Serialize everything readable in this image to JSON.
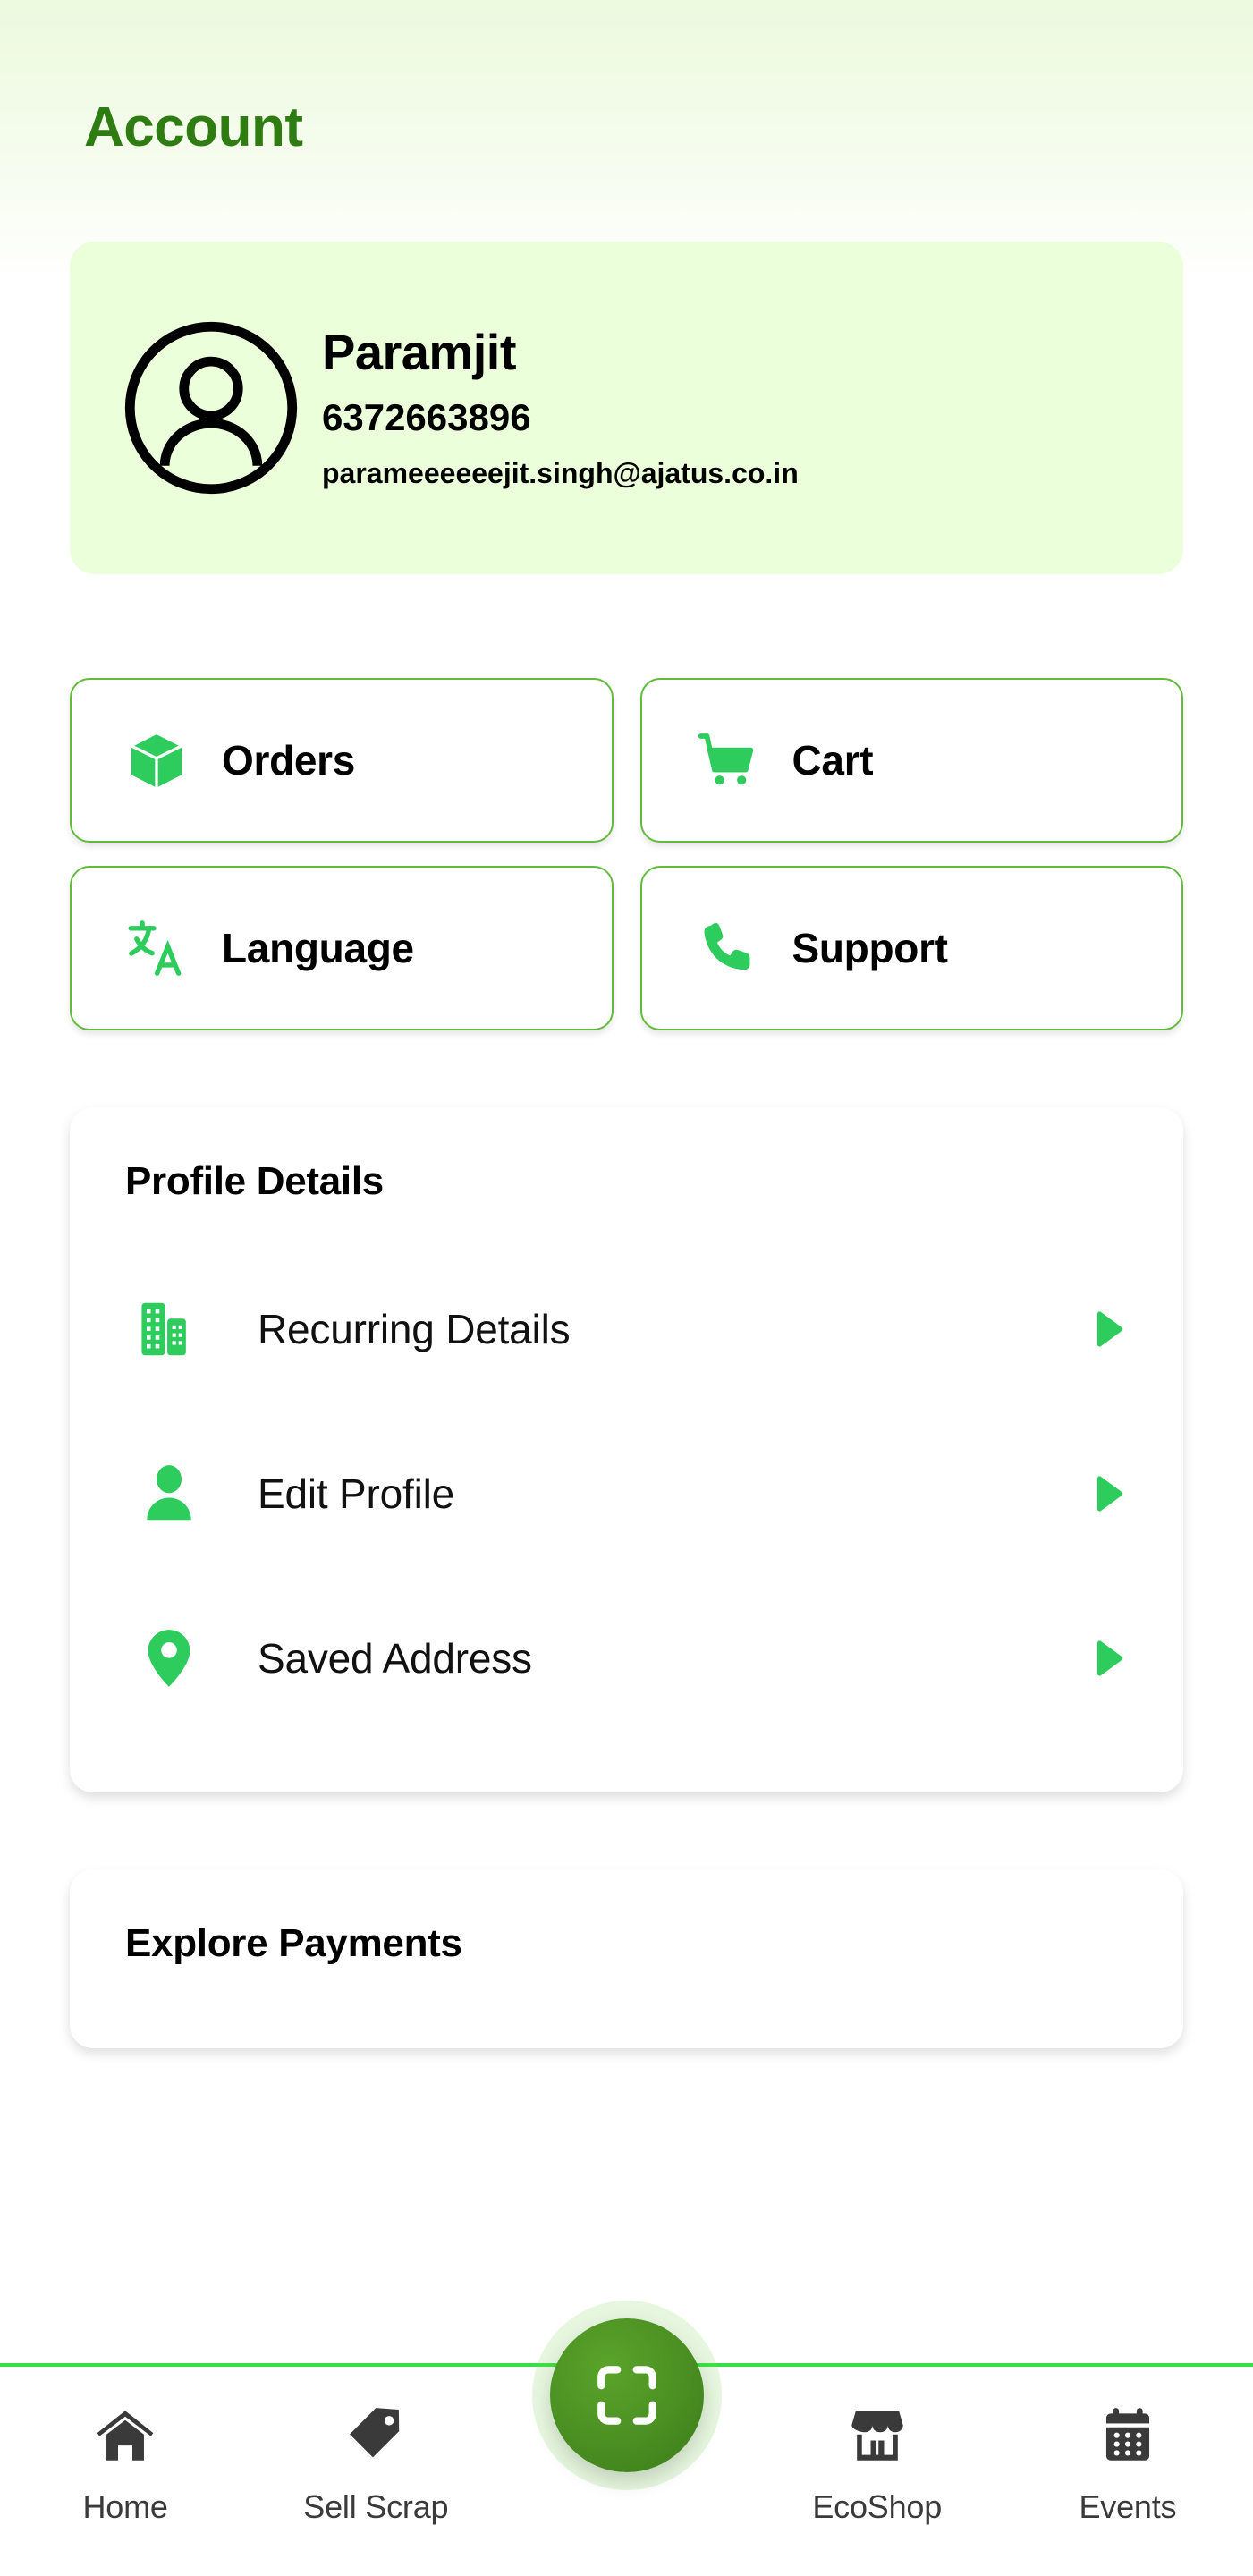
{
  "header": {
    "title": "Account"
  },
  "profile": {
    "avatar_icon": "user-circle-icon",
    "name": "Paramjit",
    "phone": "6372663896",
    "email": "parameeeeeejit.singh@ajatus.co.in"
  },
  "quick_actions": [
    {
      "label": "Orders",
      "icon": "box-3d-icon"
    },
    {
      "label": "Cart",
      "icon": "shopping-cart-icon"
    },
    {
      "label": "Language",
      "icon": "translate-icon"
    },
    {
      "label": "Support",
      "icon": "phone-call-icon"
    }
  ],
  "profile_details": {
    "title": "Profile Details",
    "items": [
      {
        "label": "Recurring Details",
        "icon": "building-icon",
        "arrow": "chevron-right-icon"
      },
      {
        "label": "Edit Profile",
        "icon": "person-icon",
        "arrow": "chevron-right-icon"
      },
      {
        "label": "Saved Address",
        "icon": "location-pin-icon",
        "arrow": "chevron-right-icon"
      }
    ]
  },
  "explore_payments": {
    "title": "Explore Payments"
  },
  "bottom_nav": {
    "items": [
      {
        "label": "Home",
        "icon": "home-icon"
      },
      {
        "label": "Sell Scrap",
        "icon": "price-tag-icon"
      },
      {
        "label": "EcoShop",
        "icon": "store-icon"
      },
      {
        "label": "Events",
        "icon": "calendar-icon"
      }
    ],
    "center_action": {
      "icon": "scan-qr-icon"
    }
  },
  "colors": {
    "primary_green": "#2ecc5c",
    "title_green": "#2f7d12",
    "card_border_green": "#63bb3e",
    "profile_card_bg": "#ecffdb",
    "nav_border_green": "#37e048",
    "fab_green": "#4a8f22",
    "nav_icon_gray": "#3a3a3a"
  }
}
